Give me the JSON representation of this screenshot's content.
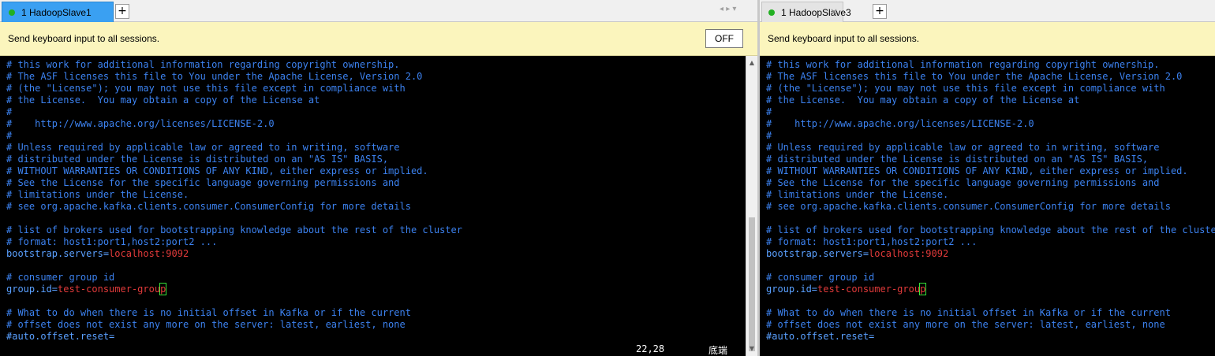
{
  "left": {
    "tab": {
      "label": "1 HadoopSlave1",
      "close": "×"
    },
    "add_tab": "+",
    "tab_nav": "◂ ▸ ▾",
    "banner": {
      "text": "Send keyboard input to all sessions.",
      "off_label": "OFF"
    },
    "status": {
      "position": "22,28",
      "mode": "底端"
    }
  },
  "right": {
    "tab": {
      "label": "1 HadoopSlave3",
      "close": "×"
    },
    "add_tab": "+",
    "banner": {
      "text": "Send keyboard input to all sessions."
    }
  },
  "terminal_lines": [
    [
      {
        "t": "# this work for additional information regarding copyright ownership.",
        "s": "c"
      }
    ],
    [
      {
        "t": "# The ASF licenses this file to You under the Apache License, Version 2.0",
        "s": "c"
      }
    ],
    [
      {
        "t": "# (the \"License\"); you may not use this file except in compliance with",
        "s": "c"
      }
    ],
    [
      {
        "t": "# the License.  You may obtain a copy of the License at",
        "s": "c"
      }
    ],
    [
      {
        "t": "#",
        "s": "c"
      }
    ],
    [
      {
        "t": "#    http://www.apache.org/licenses/LICENSE-2.0",
        "s": "c"
      }
    ],
    [
      {
        "t": "#",
        "s": "c"
      }
    ],
    [
      {
        "t": "# Unless required by applicable law or agreed to in writing, software",
        "s": "c"
      }
    ],
    [
      {
        "t": "# distributed under the License is distributed on an \"AS IS\" BASIS,",
        "s": "c"
      }
    ],
    [
      {
        "t": "# WITHOUT WARRANTIES OR CONDITIONS OF ANY KIND, either express or implied.",
        "s": "c"
      }
    ],
    [
      {
        "t": "# See the License for the specific language governing permissions and",
        "s": "c"
      }
    ],
    [
      {
        "t": "# limitations under the License.",
        "s": "c"
      }
    ],
    [
      {
        "t": "# see org.apache.kafka.clients.consumer.ConsumerConfig for more details",
        "s": "c"
      }
    ],
    [
      {
        "t": "",
        "s": "c"
      }
    ],
    [
      {
        "t": "# list of brokers used for bootstrapping knowledge about the rest of the cluster",
        "s": "c"
      }
    ],
    [
      {
        "t": "# format: host1:port1,host2:port2 ...",
        "s": "c"
      }
    ],
    [
      {
        "t": "bootstrap.servers=",
        "s": "k"
      },
      {
        "t": "localhost:9092",
        "s": "v"
      }
    ],
    [
      {
        "t": "",
        "s": "c"
      }
    ],
    [
      {
        "t": "# consumer group id",
        "s": "c"
      }
    ],
    [
      {
        "t": "group.id=",
        "s": "k"
      },
      {
        "t": "test-consumer-grou",
        "s": "v"
      },
      {
        "t": "p",
        "s": "cursor"
      }
    ],
    [
      {
        "t": "",
        "s": "c"
      }
    ],
    [
      {
        "t": "# What to do when there is no initial offset in Kafka or if the current",
        "s": "c"
      }
    ],
    [
      {
        "t": "# offset does not exist any more on the server: latest, earliest, none",
        "s": "c"
      }
    ],
    [
      {
        "t": "#auto.offset.reset=",
        "s": "k"
      }
    ]
  ]
}
